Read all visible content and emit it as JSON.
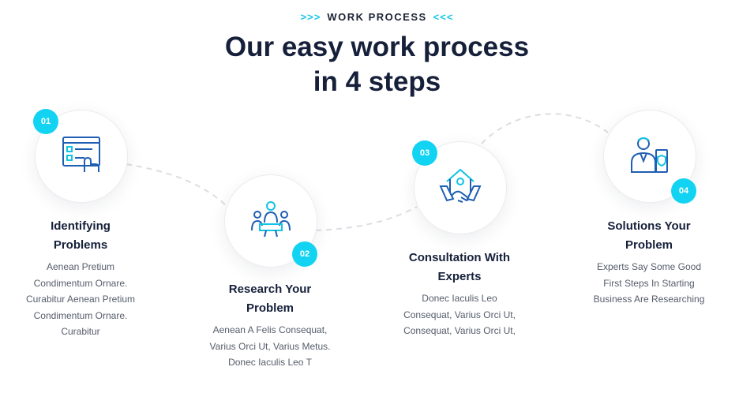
{
  "header": {
    "eyebrow_left": ">>>",
    "eyebrow": "WORK PROCESS",
    "eyebrow_right": "<<<",
    "headline_line1": "Our easy work process",
    "headline_line2": "in 4 steps"
  },
  "accent_color": "#13d3f2",
  "steps": [
    {
      "number": "01",
      "icon": "checklist-icon",
      "title_line1": "Identifying",
      "title_line2": "Problems",
      "desc": [
        "Aenean Pretium",
        "Condimentum Ornare.",
        "Curabitur Aenean Pretium",
        "Condimentum Ornare.",
        "Curabitur"
      ]
    },
    {
      "number": "02",
      "icon": "team-meeting-icon",
      "title_line1": "Research Your",
      "title_line2": "Problem",
      "desc": [
        "Aenean A Felis Consequat,",
        "Varius Orci Ut, Varius Metus.",
        "Donec Iaculis Leo T"
      ]
    },
    {
      "number": "03",
      "icon": "handshake-house-icon",
      "title_line1": "Consultation With",
      "title_line2": "Experts",
      "desc": [
        "Donec Iaculis Leo",
        "Consequat, Varius Orci Ut,",
        "Consequat, Varius Orci Ut,"
      ]
    },
    {
      "number": "04",
      "icon": "expert-shield-icon",
      "title_line1": "Solutions Your",
      "title_line2": "Problem",
      "desc": [
        "Experts Say Some Good",
        "First Steps In Starting",
        "Business Are Researching"
      ]
    }
  ]
}
